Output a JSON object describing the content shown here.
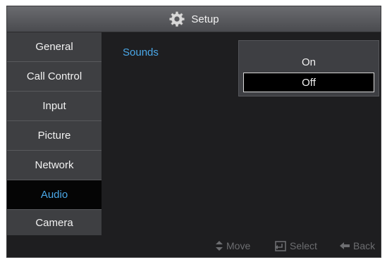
{
  "header": {
    "title": "Setup",
    "icon": "gear-icon"
  },
  "sidebar": {
    "items": [
      {
        "label": "General"
      },
      {
        "label": "Call Control"
      },
      {
        "label": "Input"
      },
      {
        "label": "Picture"
      },
      {
        "label": "Network"
      },
      {
        "label": "Audio",
        "selected": true
      },
      {
        "label": "Camera"
      }
    ]
  },
  "main": {
    "setting_label": "Sounds",
    "dropdown": {
      "options": [
        {
          "label": "On"
        },
        {
          "label": "Off",
          "selected": true
        }
      ]
    }
  },
  "footer": {
    "hints": [
      {
        "icon": "up-down-arrows-icon",
        "label": "Move"
      },
      {
        "icon": "enter-icon",
        "label": "Select"
      },
      {
        "icon": "back-arrow-icon",
        "label": "Back"
      }
    ]
  },
  "colors": {
    "accent": "#4aa8e8",
    "panel": "#3e3f42",
    "background": "#1e1e20",
    "selected_bg": "#050505"
  }
}
